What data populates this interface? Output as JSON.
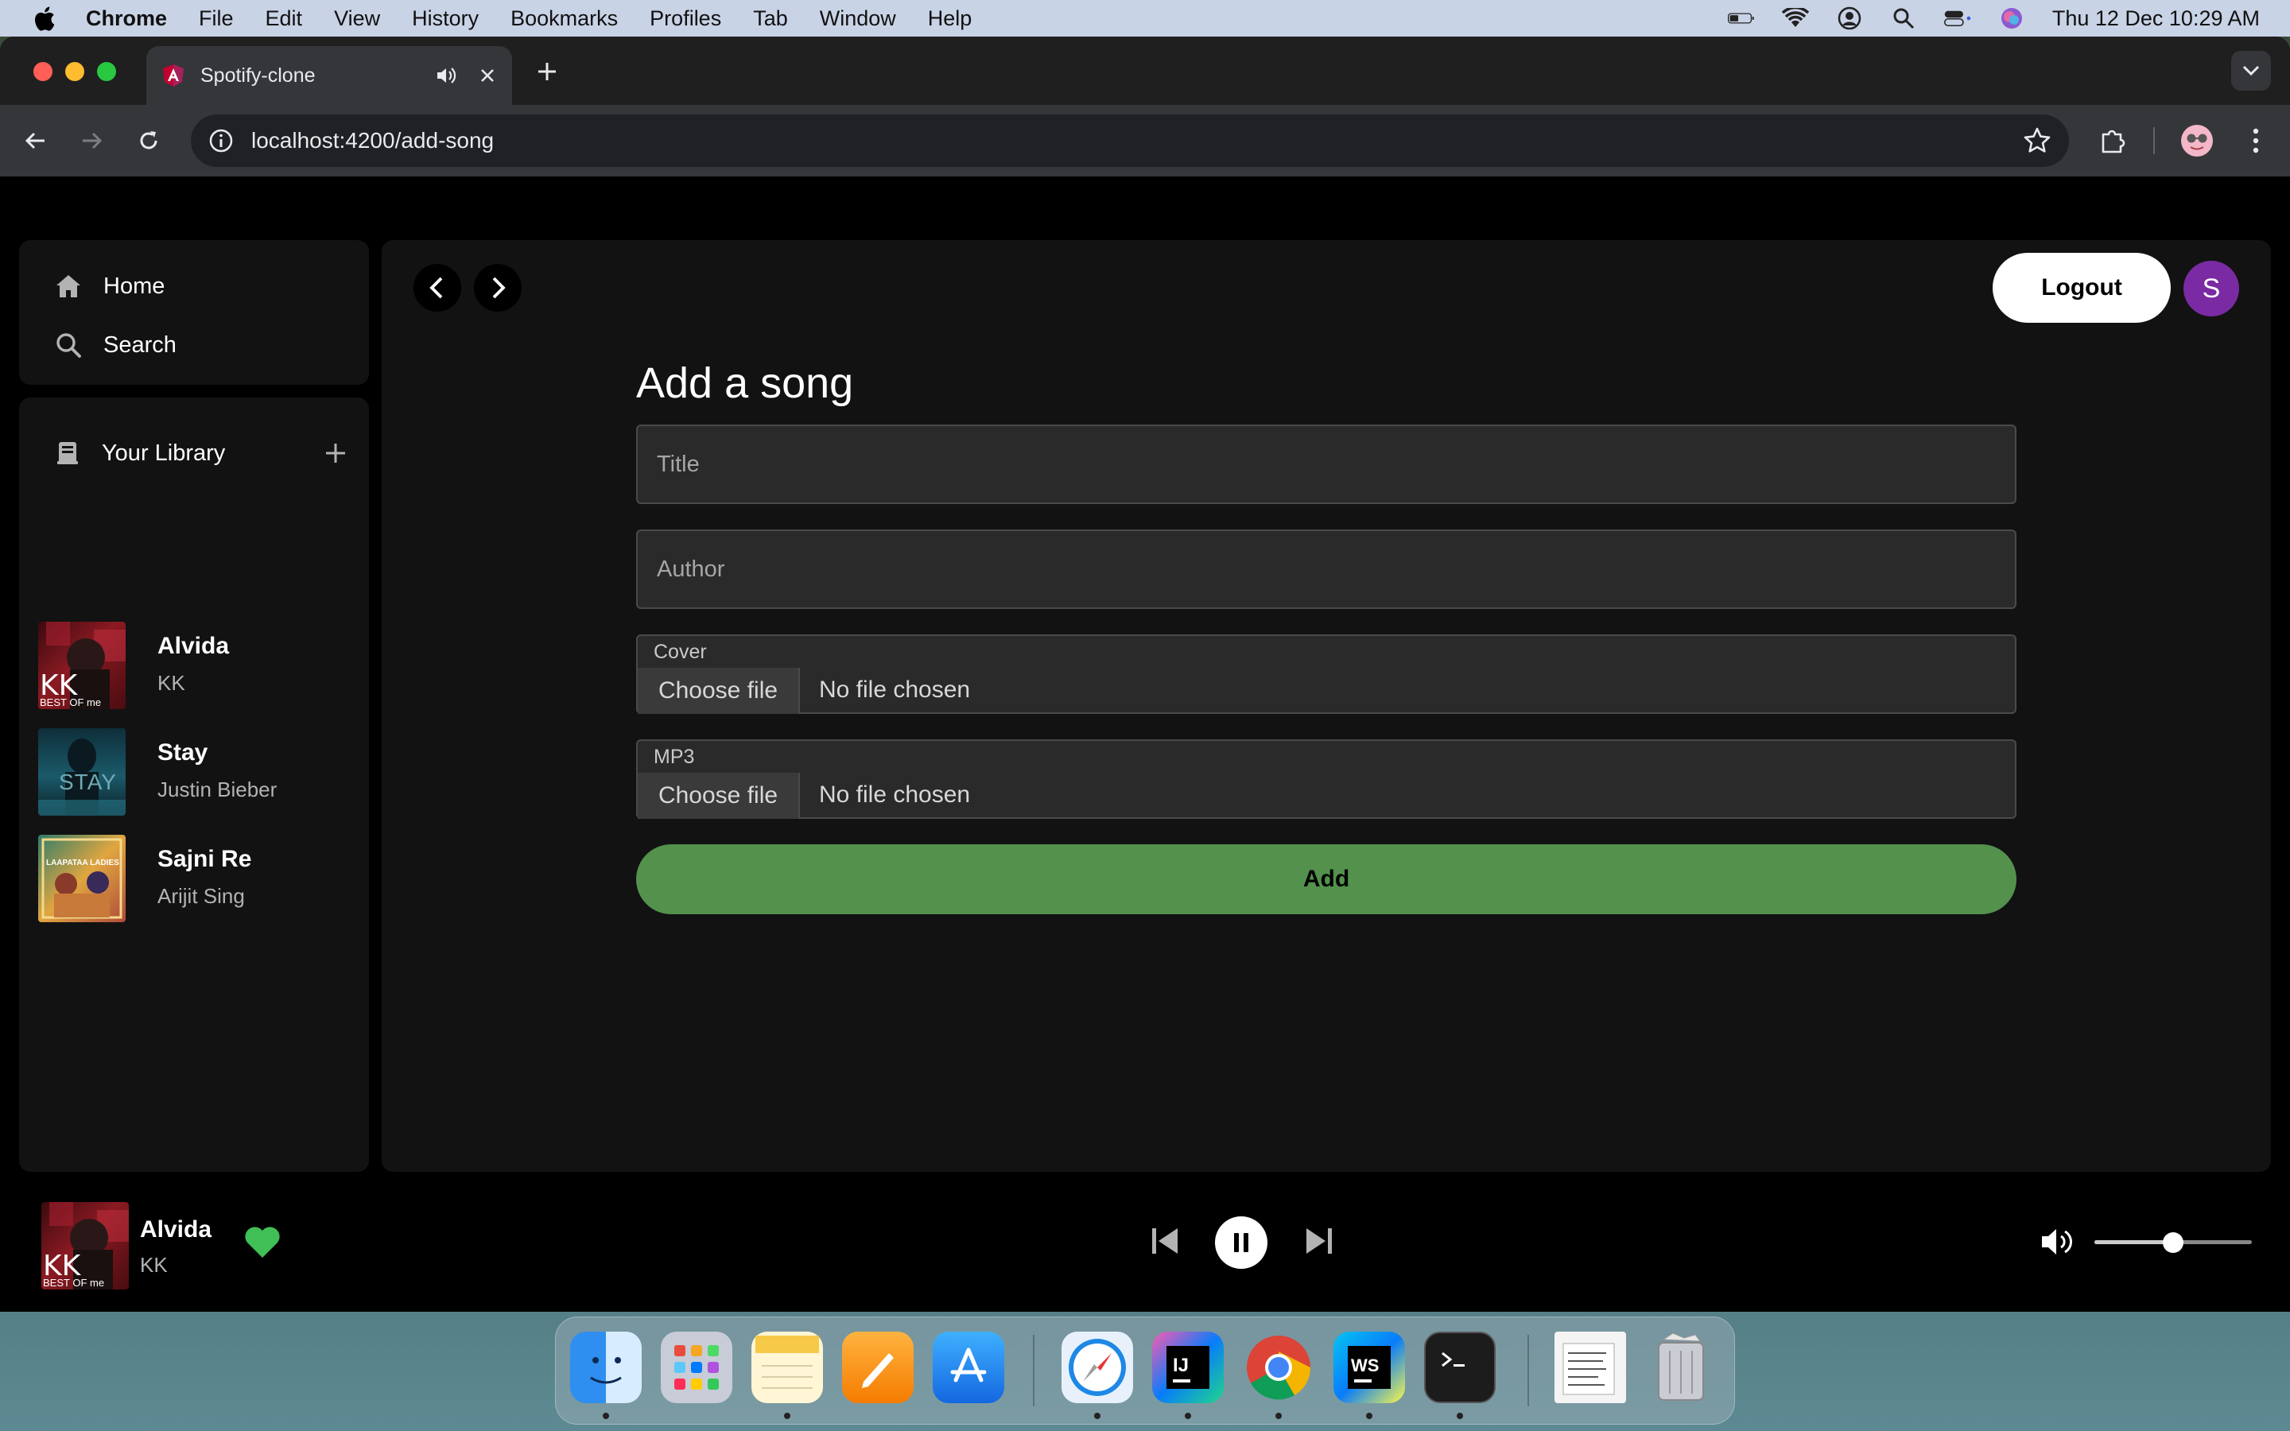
{
  "menubar": {
    "app_name": "Chrome",
    "menus": [
      "File",
      "Edit",
      "View",
      "History",
      "Bookmarks",
      "Profiles",
      "Tab",
      "Window",
      "Help"
    ],
    "datetime": "Thu 12 Dec  10:29 AM"
  },
  "browser": {
    "tab_title": "Spotify-clone",
    "url": "localhost:4200/add-song"
  },
  "sidebar": {
    "nav": [
      {
        "label": "Home",
        "icon": "home-icon"
      },
      {
        "label": "Search",
        "icon": "search-icon"
      }
    ],
    "library_label": "Your Library",
    "songs": [
      {
        "title": "Alvida",
        "artist": "KK"
      },
      {
        "title": "Stay",
        "artist": "Justin Bieber"
      },
      {
        "title": "Sajni Re",
        "artist": "Arijit Sing"
      }
    ]
  },
  "header": {
    "logout_label": "Logout",
    "avatar_initial": "S"
  },
  "form": {
    "heading": "Add a song",
    "title_placeholder": "Title",
    "author_placeholder": "Author",
    "cover_label": "Cover",
    "mp3_label": "MP3",
    "choose_file_label": "Choose file",
    "no_file_label": "No file chosen",
    "submit_label": "Add"
  },
  "player": {
    "title": "Alvida",
    "artist": "KK",
    "liked": true,
    "volume_fraction": 0.5
  },
  "colors": {
    "accent_green": "#53914d",
    "heart_green": "#1ed760",
    "avatar_purple": "#7a2aa2"
  },
  "cover_overlays": {
    "kk": "KK",
    "kk_sub": "BEST OF me",
    "stay": "STAY",
    "sajni": "LAAPATAA LADIES"
  }
}
